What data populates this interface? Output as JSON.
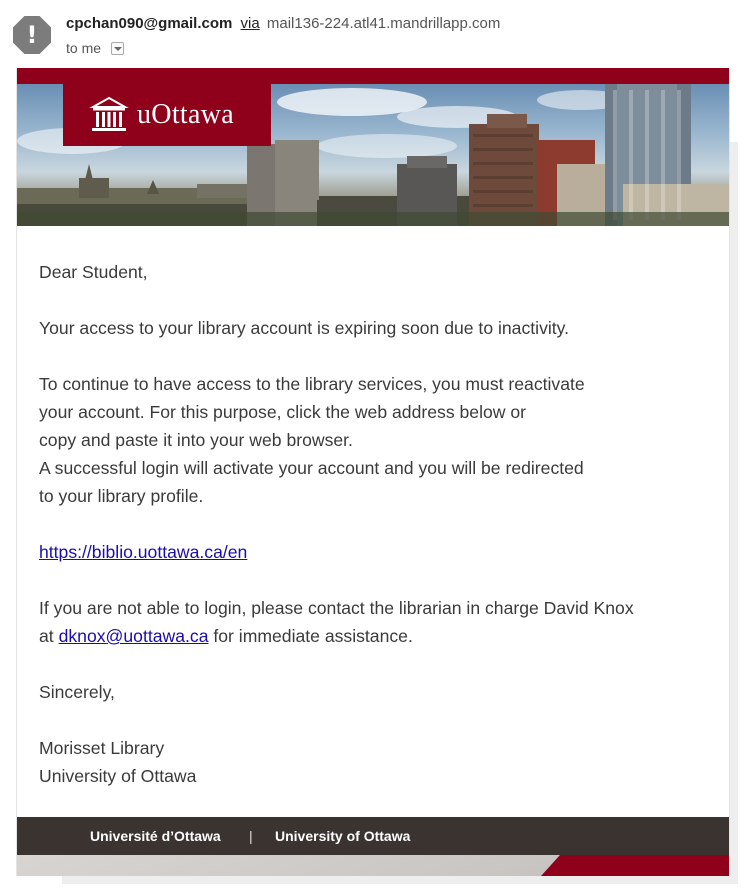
{
  "sender": {
    "avatar_glyph": "!",
    "email": "cpchan090@gmail.com",
    "via_label": "via",
    "domain": "mail136-224.atl41.mandrillapp.com",
    "recipient": "to me"
  },
  "banner": {
    "logo_text": "uOttawa",
    "brand_color": "#8f001a"
  },
  "body": {
    "greeting": "Dear Student,",
    "para1": "Your access to your library account is expiring soon due to inactivity.",
    "para2_lines": [
      "To continue to have access to the library services, you must reactivate",
      "your account. For this purpose, click the web address below or",
      "copy and paste it into your web browser.",
      "A successful login will activate your account and you will be redirected",
      "to your library profile."
    ],
    "link": "https://biblio.uottawa.ca/en",
    "contact_line1": "If you are not able to login, please contact the librarian in charge David Knox",
    "contact_at": "at",
    "contact_email": "dknox@uottawa.ca",
    "contact_tail": "for immediate assistance.",
    "closing": "Sincerely,",
    "signature_line1": "Morisset Library",
    "signature_line2": "University of Ottawa"
  },
  "footer": {
    "label_fr": "Université d’Ottawa",
    "separator": "|",
    "label_en": "University of Ottawa"
  }
}
